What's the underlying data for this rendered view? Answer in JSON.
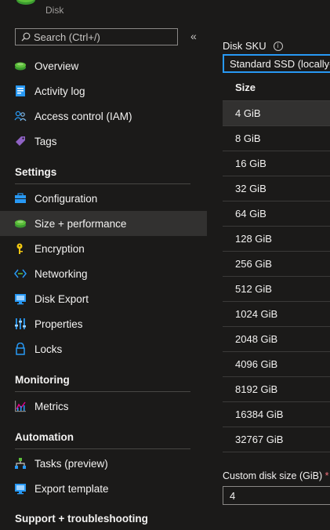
{
  "header": {
    "resource_title": "",
    "resource_type": "Disk"
  },
  "search": {
    "placeholder": "Search (Ctrl+/)"
  },
  "collapse_glyph": "«",
  "nav": {
    "overview": "Overview",
    "activity_log": "Activity log",
    "access_control": "Access control (IAM)",
    "tags": "Tags",
    "settings_heading": "Settings",
    "configuration": "Configuration",
    "size_performance": "Size + performance",
    "encryption": "Encryption",
    "networking": "Networking",
    "disk_export": "Disk Export",
    "properties": "Properties",
    "locks": "Locks",
    "monitoring_heading": "Monitoring",
    "metrics": "Metrics",
    "automation_heading": "Automation",
    "tasks": "Tasks (preview)",
    "export_template": "Export template",
    "support_heading": "Support + troubleshooting"
  },
  "main": {
    "disk_sku_label": "Disk SKU",
    "info_glyph": "i",
    "disk_sku_value": "Standard SSD (locally-redundant storage)",
    "size_column_header": "Size",
    "sizes": [
      "4 GiB",
      "8 GiB",
      "16 GiB",
      "32 GiB",
      "64 GiB",
      "128 GiB",
      "256 GiB",
      "512 GiB",
      "1024 GiB",
      "2048 GiB",
      "4096 GiB",
      "8192 GiB",
      "16384 GiB",
      "32767 GiB"
    ],
    "selected_size": "4 GiB",
    "custom_size_label": "Custom disk size (GiB)",
    "required_marker": "*",
    "custom_size_value": "4"
  },
  "colors": {
    "accent": "#2899f5",
    "background": "#1b1a19",
    "selected_row": "#323130"
  }
}
